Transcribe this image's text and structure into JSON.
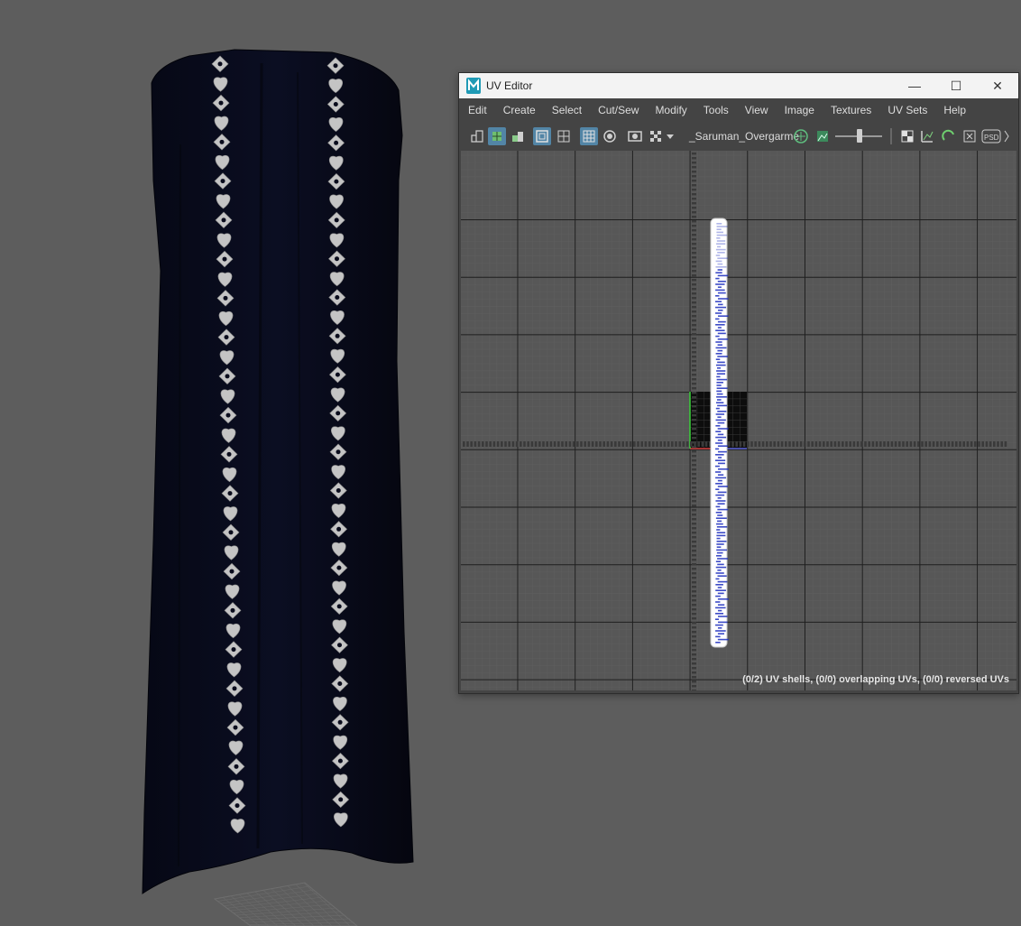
{
  "window": {
    "title": "UV Editor",
    "controls": {
      "minimize": "—",
      "maximize": "☐",
      "close": "✕"
    }
  },
  "menu": {
    "items": [
      {
        "label": "Edit"
      },
      {
        "label": "Create"
      },
      {
        "label": "Select"
      },
      {
        "label": "Cut/Sew"
      },
      {
        "label": "Modify"
      },
      {
        "label": "Tools"
      },
      {
        "label": "View"
      },
      {
        "label": "Image"
      },
      {
        "label": "Textures"
      },
      {
        "label": "UV Sets"
      },
      {
        "label": "Help"
      }
    ]
  },
  "toolbar": {
    "uv_set_name": "_Saruman_Overgarme",
    "icons": [
      "uv-shell-icon",
      "uv-select-icon",
      "isolate-icon",
      "texture-border-icon",
      "grid-icon",
      "filter-icon",
      "shaded-icon",
      "image-icon",
      "checker-icon",
      "dropdown-arrow-icon",
      "uv-distortion-icon",
      "image-display-icon",
      "exposure-icon",
      "checker-map-icon",
      "texel-density-icon",
      "snap-icon",
      "layout-icon",
      "psd-icon"
    ],
    "exposure_level": 0.55
  },
  "status": {
    "text": "(0/2) UV shells, (0/0) overlapping UVs, (0/0) reversed UVs"
  },
  "colors": {
    "viewport_bg": "#5d5d5d",
    "cloak": "#090b1b",
    "trim": "#c4c4c4",
    "uv_grid_bg": "#575757",
    "uv_shell": "#1a2bbd",
    "accent": "#5285a6"
  }
}
